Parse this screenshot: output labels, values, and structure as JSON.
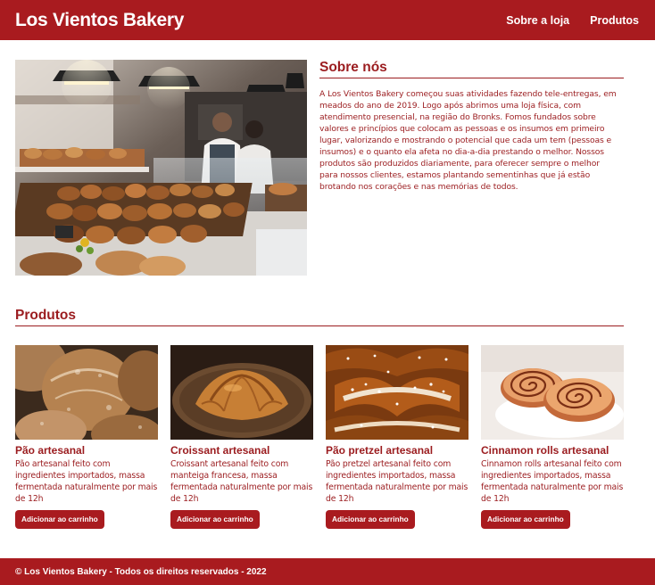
{
  "header": {
    "brand": "Los Vientos Bakery",
    "nav": [
      "Sobre a loja",
      "Produtos"
    ]
  },
  "about": {
    "title": "Sobre nós",
    "text": "A Los Vientos Bakery começou suas atividades fazendo tele-entregas, em meados do ano de 2019. Logo após abrimos uma loja física, com atendimento presencial, na região do Bronks. Fomos fundados sobre valores e princípios que colocam as pessoas e os insumos em primeiro lugar, valorizando e mostrando o potencial que cada um tem (pessoas e insumos) e o quanto ela afeta no dia-a-dia prestando o melhor. Nossos produtos são produzidos diariamente, para oferecer sempre o melhor para nossos clientes, estamos plantando sementinhas que já estão brotando nos corações e nas memórias de todos."
  },
  "products": {
    "title": "Produtos",
    "items": [
      {
        "name": "Pão artesanal",
        "desc": "Pão artesanal feito com ingredientes importados, massa fermentada naturalmente por mais de 12h",
        "button": "Adicionar ao carrinho"
      },
      {
        "name": "Croissant artesanal",
        "desc": "Croissant artesanal feito com manteiga francesa, massa fermentada naturalmente por mais de 12h",
        "button": "Adicionar ao carrinho"
      },
      {
        "name": "Pão pretzel artesanal",
        "desc": "Pão pretzel artesanal feito com ingredientes importados, massa fermentada naturalmente por mais de 12h",
        "button": "Adicionar ao carrinho"
      },
      {
        "name": "Cinnamon rolls artesanal",
        "desc": "Cinnamon rolls artesanal feito com ingredientes importados, massa fermentada naturalmente por mais de 12h",
        "button": "Adicionar ao carrinho"
      }
    ]
  },
  "footer": {
    "text": "© Los Vientos Bakery - Todos os direitos reservados - 2022"
  },
  "colors": {
    "brand_red": "#a91b1f",
    "text_red": "#9b1c1f"
  }
}
